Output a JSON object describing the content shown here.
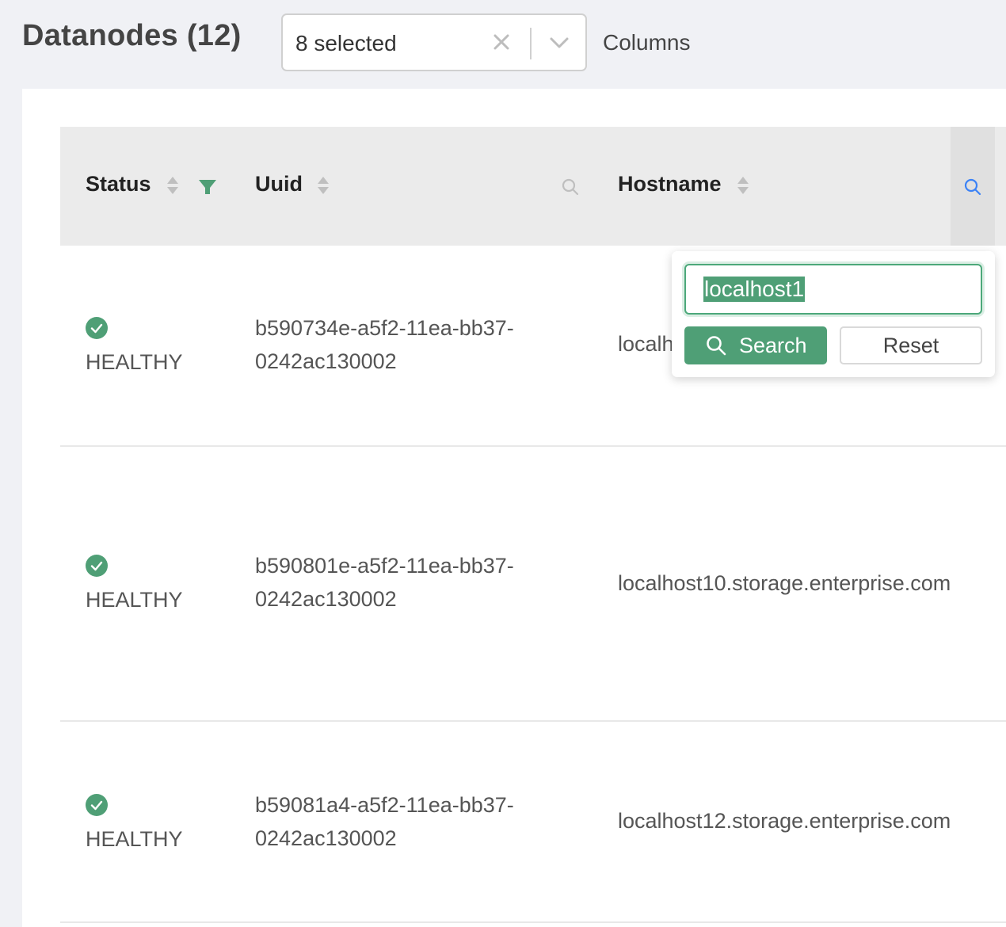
{
  "header": {
    "title": "Datanodes (12)",
    "column_select_value": "8 selected",
    "columns_label": "Columns"
  },
  "table": {
    "columns": [
      {
        "label": "Status",
        "sortable": true,
        "filter_active": true
      },
      {
        "label": "Uuid",
        "sortable": true,
        "search_active": false
      },
      {
        "label": "Hostname",
        "sortable": true,
        "search_active": true
      }
    ],
    "rows": [
      {
        "status": "HEALTHY",
        "uuid_line1": "b590734e-a5f2-11ea-bb37-",
        "uuid_line2": "0242ac130002",
        "hostname": "localh"
      },
      {
        "status": "HEALTHY",
        "uuid_line1": "b590801e-a5f2-11ea-bb37-",
        "uuid_line2": "0242ac130002",
        "hostname": "localhost10.storage.enterprise.com"
      },
      {
        "status": "HEALTHY",
        "uuid_line1": "b59081a4-a5f2-11ea-bb37-",
        "uuid_line2": "0242ac130002",
        "hostname": "localhost12.storage.enterprise.com"
      }
    ]
  },
  "search_dropdown": {
    "input_value": "localhost1",
    "search_label": "Search",
    "reset_label": "Reset"
  },
  "colors": {
    "accent": "#4f9f76",
    "active_search_icon": "#3b82f6"
  }
}
